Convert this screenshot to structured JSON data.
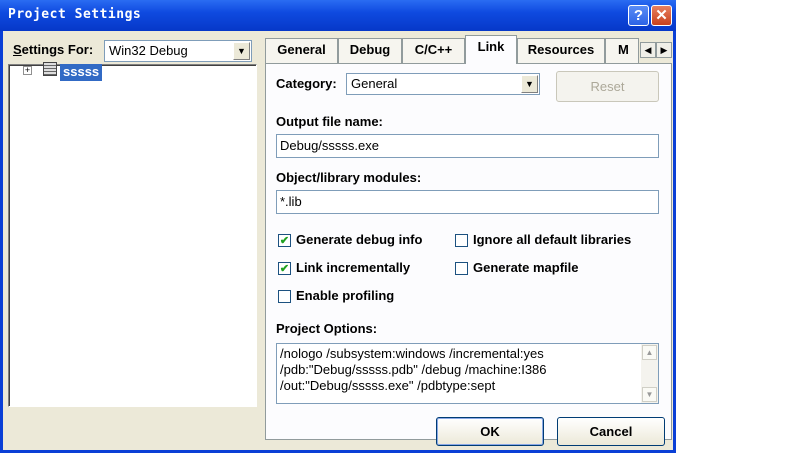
{
  "window": {
    "title": "Project Settings",
    "help_glyph": "?",
    "close_glyph": "✕"
  },
  "left": {
    "settings_for_label_pre": "S",
    "settings_for_label_rest": "ettings For:",
    "target": "Win32 Debug",
    "tree": {
      "expander": "+",
      "project": "sssss"
    }
  },
  "tabs": [
    {
      "label": "General"
    },
    {
      "label": "Debug"
    },
    {
      "label": "C/C++"
    },
    {
      "label": "Link",
      "active": true
    },
    {
      "label": "Resources"
    },
    {
      "label": "M"
    }
  ],
  "link": {
    "category_label": "Category:",
    "category_value": "General",
    "reset_label": "Reset",
    "output_label": "Output file name:",
    "output_value": "Debug/sssss.exe",
    "objlib_label": "Object/library modules:",
    "objlib_value": "*.lib",
    "checkboxes": [
      {
        "label": "Generate debug info",
        "checked": true
      },
      {
        "label": "Link incrementally",
        "checked": true
      },
      {
        "label": "Enable profiling",
        "checked": false
      },
      {
        "label": "Ignore all default libraries",
        "checked": false
      },
      {
        "label": "Generate mapfile",
        "checked": false
      }
    ],
    "project_options_label": "Project Options:",
    "project_options": "/nologo /subsystem:windows /incremental:yes\n/pdb:\"Debug/sssss.pdb\" /debug /machine:I386\n/out:\"Debug/sssss.exe\" /pdbtype:sept"
  },
  "buttons": {
    "ok": "OK",
    "cancel": "Cancel"
  },
  "check_mark": "✔",
  "icons": {
    "combo_arrow": "chevron-down-icon",
    "project": "project-icon",
    "scroll_left": "◀",
    "scroll_right": "▶",
    "scroll_up": "▲",
    "scroll_down": "▼"
  },
  "colors": {
    "titlebar": "#0a3fd6",
    "selection": "#316ac5",
    "face": "#ece9d8"
  }
}
